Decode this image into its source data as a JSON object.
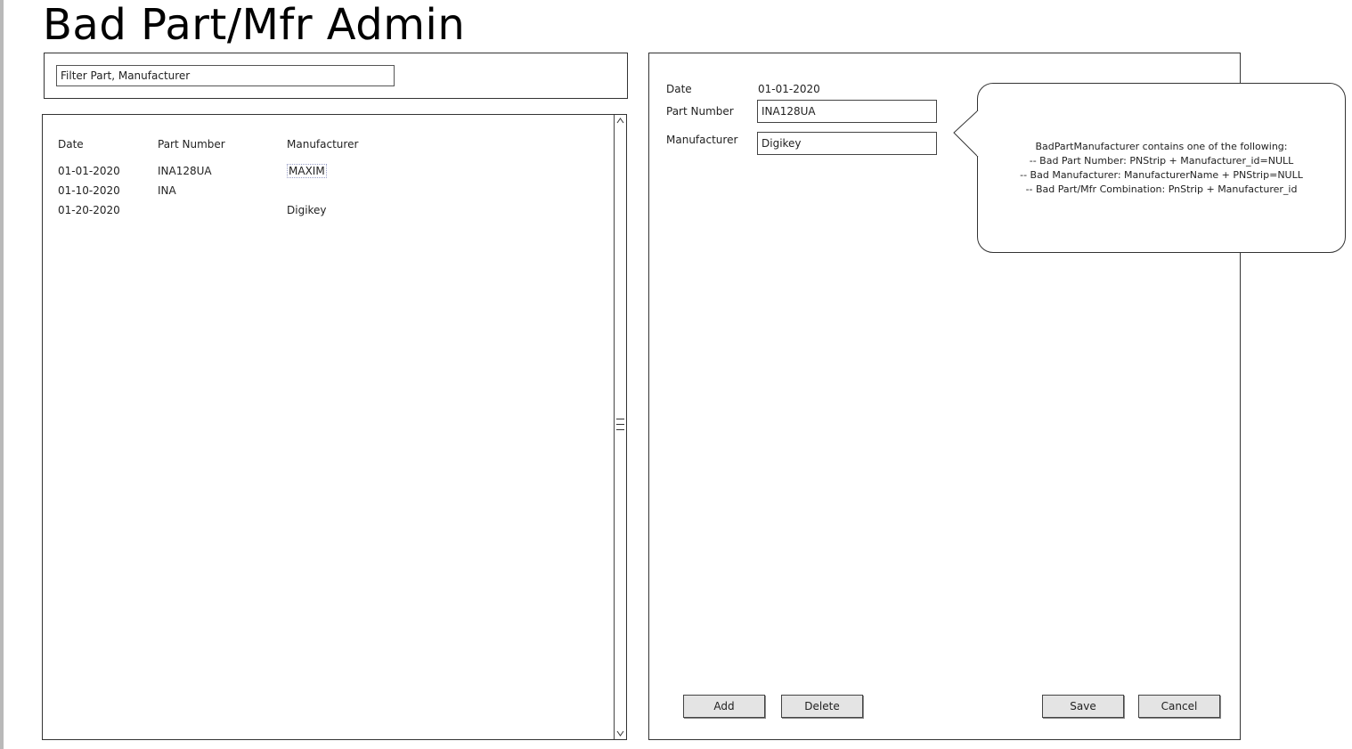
{
  "title": "Bad Part/Mfr Admin",
  "filter": {
    "value": "Filter Part, Manufacturer"
  },
  "list": {
    "headers": {
      "date": "Date",
      "part_number": "Part Number",
      "manufacturer": "Manufacturer"
    },
    "rows": [
      {
        "date": "01-01-2020",
        "part_number": "INA128UA",
        "manufacturer": "MAXIM"
      },
      {
        "date": "01-10-2020",
        "part_number": "INA",
        "manufacturer": ""
      },
      {
        "date": "01-20-2020",
        "part_number": "",
        "manufacturer": "Digikey"
      }
    ]
  },
  "detail": {
    "date_label": "Date",
    "date_value": "01-01-2020",
    "part_number_label": "Part Number",
    "part_number_value": "INA128UA",
    "manufacturer_label": "Manufacturer",
    "manufacturer_value": "Digikey"
  },
  "buttons": {
    "add": "Add",
    "delete": "Delete",
    "save": "Save",
    "cancel": "Cancel"
  },
  "callout": {
    "lines": [
      "BadPartManufacturer contains one of the following:",
      "-- Bad Part Number: PNStrip + Manufacturer_id=NULL",
      "-- Bad Manufacturer: ManufacturerName + PNStrip=NULL",
      "-- Bad Part/Mfr Combination: PnStrip + Manufacturer_id"
    ]
  }
}
